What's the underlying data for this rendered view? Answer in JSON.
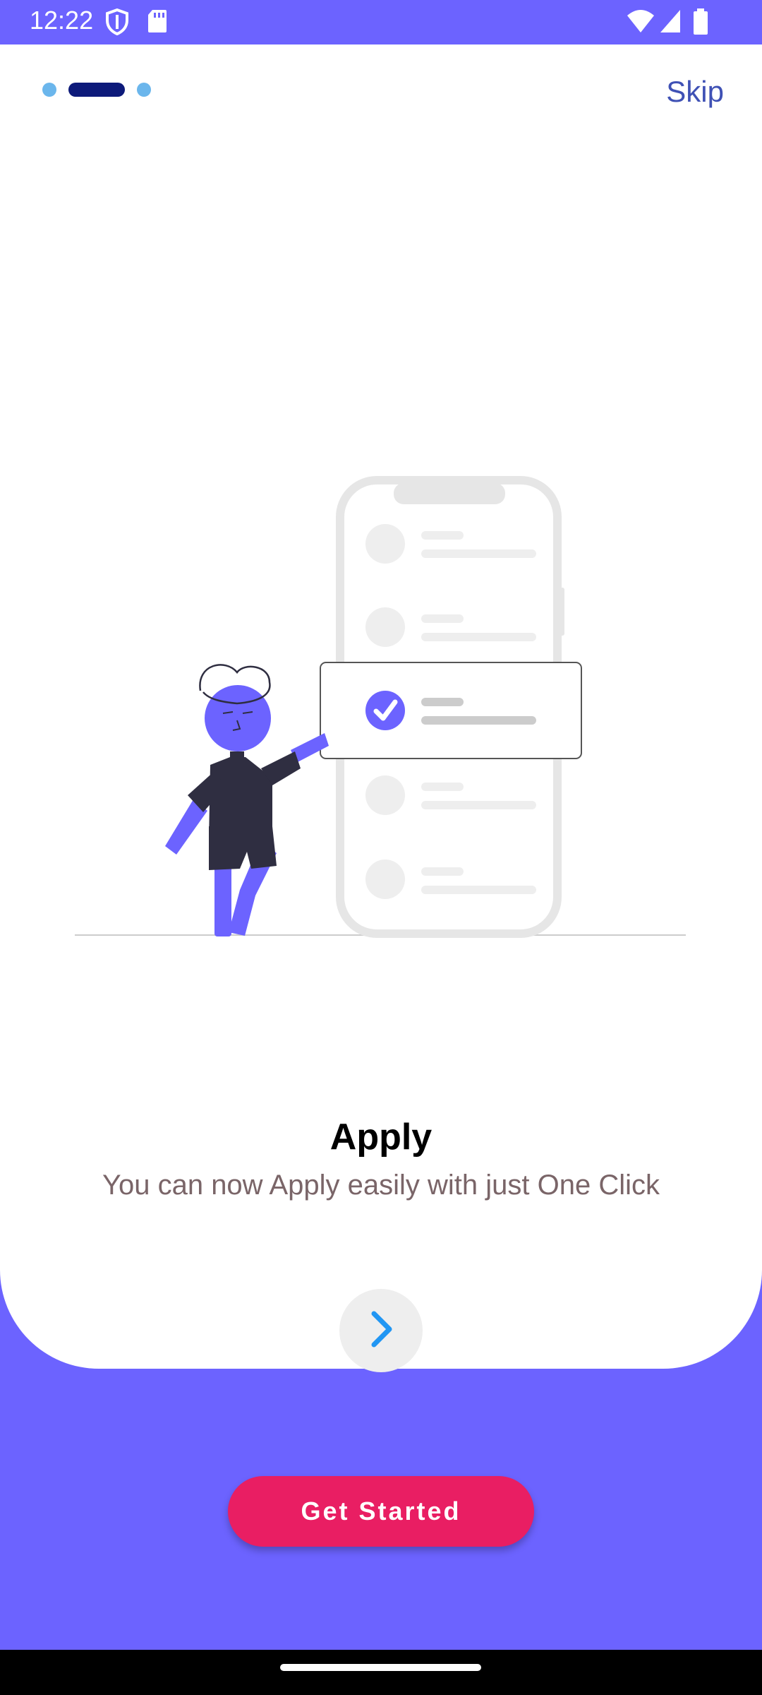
{
  "status_bar": {
    "time": "12:22",
    "left_icons": [
      "shield-icon",
      "sd-card-icon"
    ],
    "right_icons": [
      "wifi-icon",
      "signal-icon",
      "battery-icon"
    ]
  },
  "onboarding": {
    "page_indicator": {
      "total": 3,
      "active_index": 1
    },
    "skip_label": "Skip",
    "illustration": "person-checking-list-on-phone",
    "title": "Apply",
    "subtitle": "You can now Apply easily with just One Click",
    "next_icon": "chevron-right-icon",
    "get_started_label": "Get Started"
  },
  "colors": {
    "background": "#6C63FF",
    "card": "#FFFFFF",
    "accent": "#6C63FF",
    "dot_inactive": "#6BB6EC",
    "dot_active": "#0D1A7A",
    "skip_text": "#3F51B5",
    "subtitle_text": "#7A6568",
    "cta": "#E91E63",
    "chevron": "#2196F3"
  }
}
